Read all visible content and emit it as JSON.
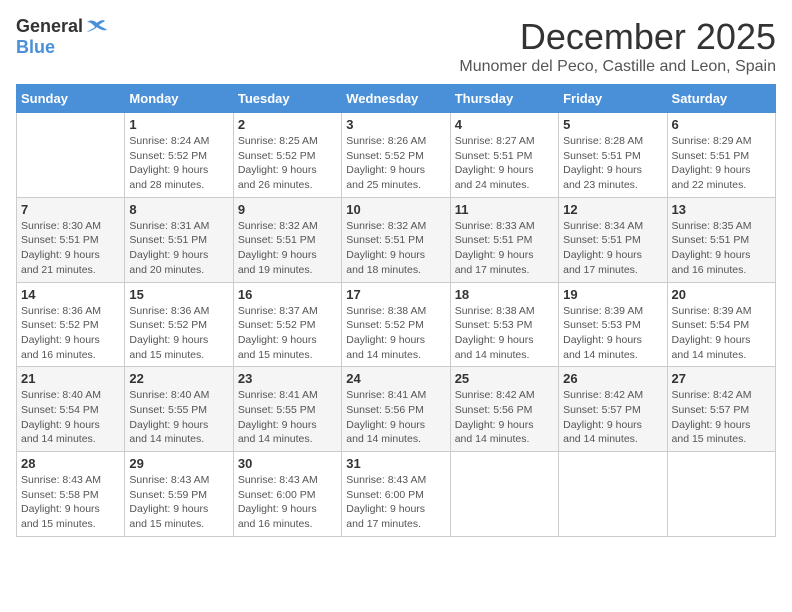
{
  "logo": {
    "general": "General",
    "blue": "Blue"
  },
  "title": "December 2025",
  "subtitle": "Munomer del Peco, Castille and Leon, Spain",
  "days_header": [
    "Sunday",
    "Monday",
    "Tuesday",
    "Wednesday",
    "Thursday",
    "Friday",
    "Saturday"
  ],
  "weeks": [
    [
      {
        "day": "",
        "info": ""
      },
      {
        "day": "1",
        "info": "Sunrise: 8:24 AM\nSunset: 5:52 PM\nDaylight: 9 hours\nand 28 minutes."
      },
      {
        "day": "2",
        "info": "Sunrise: 8:25 AM\nSunset: 5:52 PM\nDaylight: 9 hours\nand 26 minutes."
      },
      {
        "day": "3",
        "info": "Sunrise: 8:26 AM\nSunset: 5:52 PM\nDaylight: 9 hours\nand 25 minutes."
      },
      {
        "day": "4",
        "info": "Sunrise: 8:27 AM\nSunset: 5:51 PM\nDaylight: 9 hours\nand 24 minutes."
      },
      {
        "day": "5",
        "info": "Sunrise: 8:28 AM\nSunset: 5:51 PM\nDaylight: 9 hours\nand 23 minutes."
      },
      {
        "day": "6",
        "info": "Sunrise: 8:29 AM\nSunset: 5:51 PM\nDaylight: 9 hours\nand 22 minutes."
      }
    ],
    [
      {
        "day": "7",
        "info": "Sunrise: 8:30 AM\nSunset: 5:51 PM\nDaylight: 9 hours\nand 21 minutes."
      },
      {
        "day": "8",
        "info": "Sunrise: 8:31 AM\nSunset: 5:51 PM\nDaylight: 9 hours\nand 20 minutes."
      },
      {
        "day": "9",
        "info": "Sunrise: 8:32 AM\nSunset: 5:51 PM\nDaylight: 9 hours\nand 19 minutes."
      },
      {
        "day": "10",
        "info": "Sunrise: 8:32 AM\nSunset: 5:51 PM\nDaylight: 9 hours\nand 18 minutes."
      },
      {
        "day": "11",
        "info": "Sunrise: 8:33 AM\nSunset: 5:51 PM\nDaylight: 9 hours\nand 17 minutes."
      },
      {
        "day": "12",
        "info": "Sunrise: 8:34 AM\nSunset: 5:51 PM\nDaylight: 9 hours\nand 17 minutes."
      },
      {
        "day": "13",
        "info": "Sunrise: 8:35 AM\nSunset: 5:51 PM\nDaylight: 9 hours\nand 16 minutes."
      }
    ],
    [
      {
        "day": "14",
        "info": "Sunrise: 8:36 AM\nSunset: 5:52 PM\nDaylight: 9 hours\nand 16 minutes."
      },
      {
        "day": "15",
        "info": "Sunrise: 8:36 AM\nSunset: 5:52 PM\nDaylight: 9 hours\nand 15 minutes."
      },
      {
        "day": "16",
        "info": "Sunrise: 8:37 AM\nSunset: 5:52 PM\nDaylight: 9 hours\nand 15 minutes."
      },
      {
        "day": "17",
        "info": "Sunrise: 8:38 AM\nSunset: 5:52 PM\nDaylight: 9 hours\nand 14 minutes."
      },
      {
        "day": "18",
        "info": "Sunrise: 8:38 AM\nSunset: 5:53 PM\nDaylight: 9 hours\nand 14 minutes."
      },
      {
        "day": "19",
        "info": "Sunrise: 8:39 AM\nSunset: 5:53 PM\nDaylight: 9 hours\nand 14 minutes."
      },
      {
        "day": "20",
        "info": "Sunrise: 8:39 AM\nSunset: 5:54 PM\nDaylight: 9 hours\nand 14 minutes."
      }
    ],
    [
      {
        "day": "21",
        "info": "Sunrise: 8:40 AM\nSunset: 5:54 PM\nDaylight: 9 hours\nand 14 minutes."
      },
      {
        "day": "22",
        "info": "Sunrise: 8:40 AM\nSunset: 5:55 PM\nDaylight: 9 hours\nand 14 minutes."
      },
      {
        "day": "23",
        "info": "Sunrise: 8:41 AM\nSunset: 5:55 PM\nDaylight: 9 hours\nand 14 minutes."
      },
      {
        "day": "24",
        "info": "Sunrise: 8:41 AM\nSunset: 5:56 PM\nDaylight: 9 hours\nand 14 minutes."
      },
      {
        "day": "25",
        "info": "Sunrise: 8:42 AM\nSunset: 5:56 PM\nDaylight: 9 hours\nand 14 minutes."
      },
      {
        "day": "26",
        "info": "Sunrise: 8:42 AM\nSunset: 5:57 PM\nDaylight: 9 hours\nand 14 minutes."
      },
      {
        "day": "27",
        "info": "Sunrise: 8:42 AM\nSunset: 5:57 PM\nDaylight: 9 hours\nand 15 minutes."
      }
    ],
    [
      {
        "day": "28",
        "info": "Sunrise: 8:43 AM\nSunset: 5:58 PM\nDaylight: 9 hours\nand 15 minutes."
      },
      {
        "day": "29",
        "info": "Sunrise: 8:43 AM\nSunset: 5:59 PM\nDaylight: 9 hours\nand 15 minutes."
      },
      {
        "day": "30",
        "info": "Sunrise: 8:43 AM\nSunset: 6:00 PM\nDaylight: 9 hours\nand 16 minutes."
      },
      {
        "day": "31",
        "info": "Sunrise: 8:43 AM\nSunset: 6:00 PM\nDaylight: 9 hours\nand 17 minutes."
      },
      {
        "day": "",
        "info": ""
      },
      {
        "day": "",
        "info": ""
      },
      {
        "day": "",
        "info": ""
      }
    ]
  ]
}
